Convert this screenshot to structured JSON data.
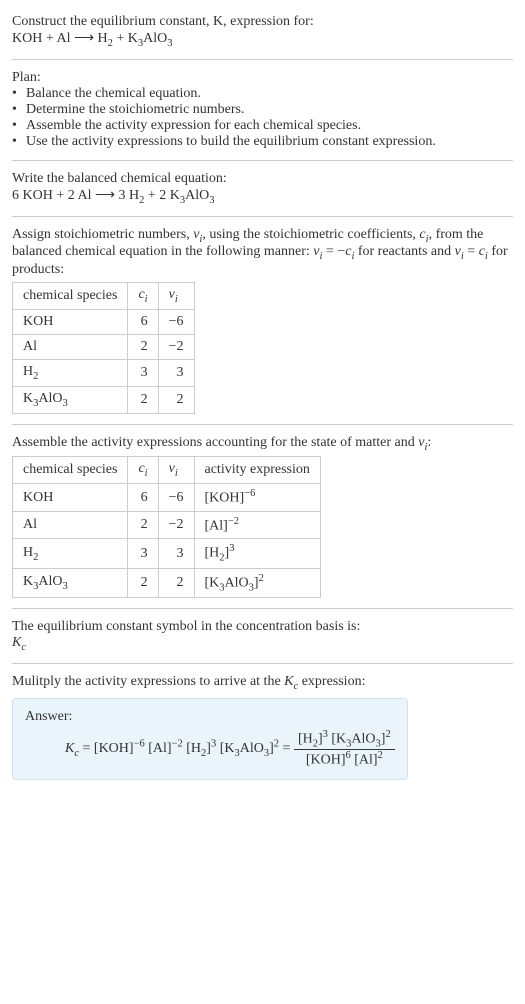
{
  "intro": {
    "line1": "Construct the equilibrium constant, K, expression for:",
    "line2_html": "KOH + Al ⟶ H<sub>2</sub> + K<sub>3</sub>AlO<sub>3</sub>"
  },
  "plan": {
    "heading": "Plan:",
    "items": [
      "Balance the chemical equation.",
      "Determine the stoichiometric numbers.",
      "Assemble the activity expression for each chemical species.",
      "Use the activity expressions to build the equilibrium constant expression."
    ]
  },
  "balanced": {
    "heading": "Write the balanced chemical equation:",
    "eq_html": "6 KOH + 2 Al ⟶ 3 H<sub>2</sub> + 2 K<sub>3</sub>AlO<sub>3</sub>"
  },
  "stoich": {
    "intro_html": "Assign stoichiometric numbers, <i>ν<sub>i</sub></i>, using the stoichiometric coefficients, <i>c<sub>i</sub></i>, from the balanced chemical equation in the following manner: <i>ν<sub>i</sub></i> = −<i>c<sub>i</sub></i> for reactants and <i>ν<sub>i</sub></i> = <i>c<sub>i</sub></i> for products:",
    "headers": {
      "species": "chemical species",
      "ci_html": "<i>c<sub>i</sub></i>",
      "vi_html": "<i>ν<sub>i</sub></i>"
    },
    "rows": [
      {
        "species_html": "KOH",
        "ci": "6",
        "vi": "−6"
      },
      {
        "species_html": "Al",
        "ci": "2",
        "vi": "−2"
      },
      {
        "species_html": "H<sub>2</sub>",
        "ci": "3",
        "vi": "3"
      },
      {
        "species_html": "K<sub>3</sub>AlO<sub>3</sub>",
        "ci": "2",
        "vi": "2"
      }
    ]
  },
  "activity": {
    "intro_html": "Assemble the activity expressions accounting for the state of matter and <i>ν<sub>i</sub></i>:",
    "headers": {
      "species": "chemical species",
      "ci_html": "<i>c<sub>i</sub></i>",
      "vi_html": "<i>ν<sub>i</sub></i>",
      "act": "activity expression"
    },
    "rows": [
      {
        "species_html": "KOH",
        "ci": "6",
        "vi": "−6",
        "act_html": "[KOH]<sup>−6</sup>"
      },
      {
        "species_html": "Al",
        "ci": "2",
        "vi": "−2",
        "act_html": "[Al]<sup>−2</sup>"
      },
      {
        "species_html": "H<sub>2</sub>",
        "ci": "3",
        "vi": "3",
        "act_html": "[H<sub>2</sub>]<sup>3</sup>"
      },
      {
        "species_html": "K<sub>3</sub>AlO<sub>3</sub>",
        "ci": "2",
        "vi": "2",
        "act_html": "[K<sub>3</sub>AlO<sub>3</sub>]<sup>2</sup>"
      }
    ]
  },
  "symbol": {
    "line1": "The equilibrium constant symbol in the concentration basis is:",
    "line2_html": "<i>K<sub>c</sub></i>"
  },
  "final": {
    "heading_html": "Mulitply the activity expressions to arrive at the <i>K<sub>c</sub></i> expression:",
    "answer_label": "Answer:",
    "kc_html": "<i>K<sub>c</sub></i> = [KOH]<sup>−6</sup> [Al]<sup>−2</sup> [H<sub>2</sub>]<sup>3</sup> [K<sub>3</sub>AlO<sub>3</sub>]<sup>2</sup> = ",
    "frac_num_html": "[H<sub>2</sub>]<sup>3</sup> [K<sub>3</sub>AlO<sub>3</sub>]<sup>2</sup>",
    "frac_den_html": "[KOH]<sup>6</sup> [Al]<sup>2</sup>"
  }
}
